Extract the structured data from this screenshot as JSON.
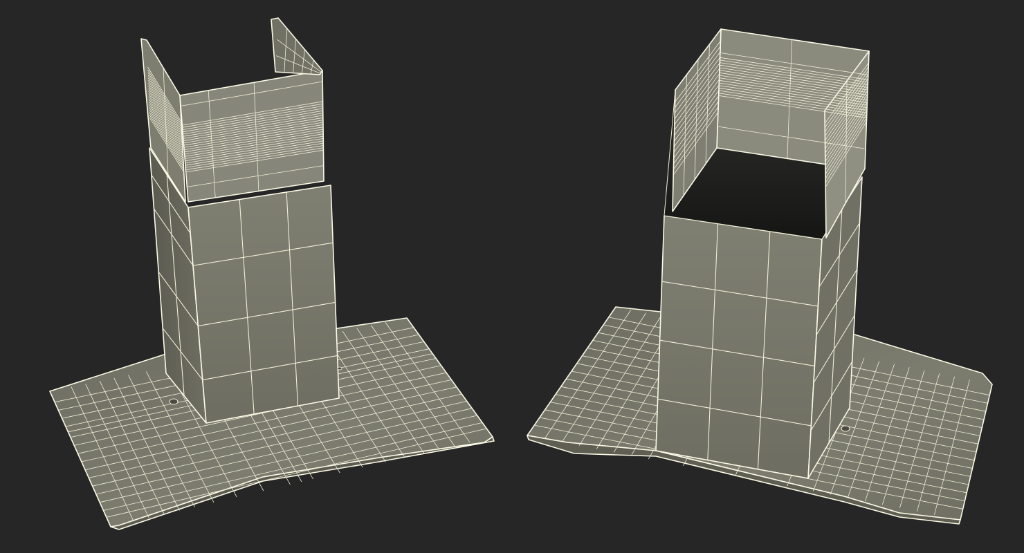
{
  "scene": {
    "background": "#262626",
    "wire_color": "#f2f0d8",
    "surface_light": "#8a8a7c",
    "surface_mid": "#7a7a6d",
    "surface_dark": "#5e5e53",
    "interior_dark": "#1e1f1c",
    "render_style": "wireframe-on-shaded"
  },
  "objects": [
    {
      "name": "range-hood-view-front"
    },
    {
      "name": "range-hood-view-back"
    }
  ]
}
